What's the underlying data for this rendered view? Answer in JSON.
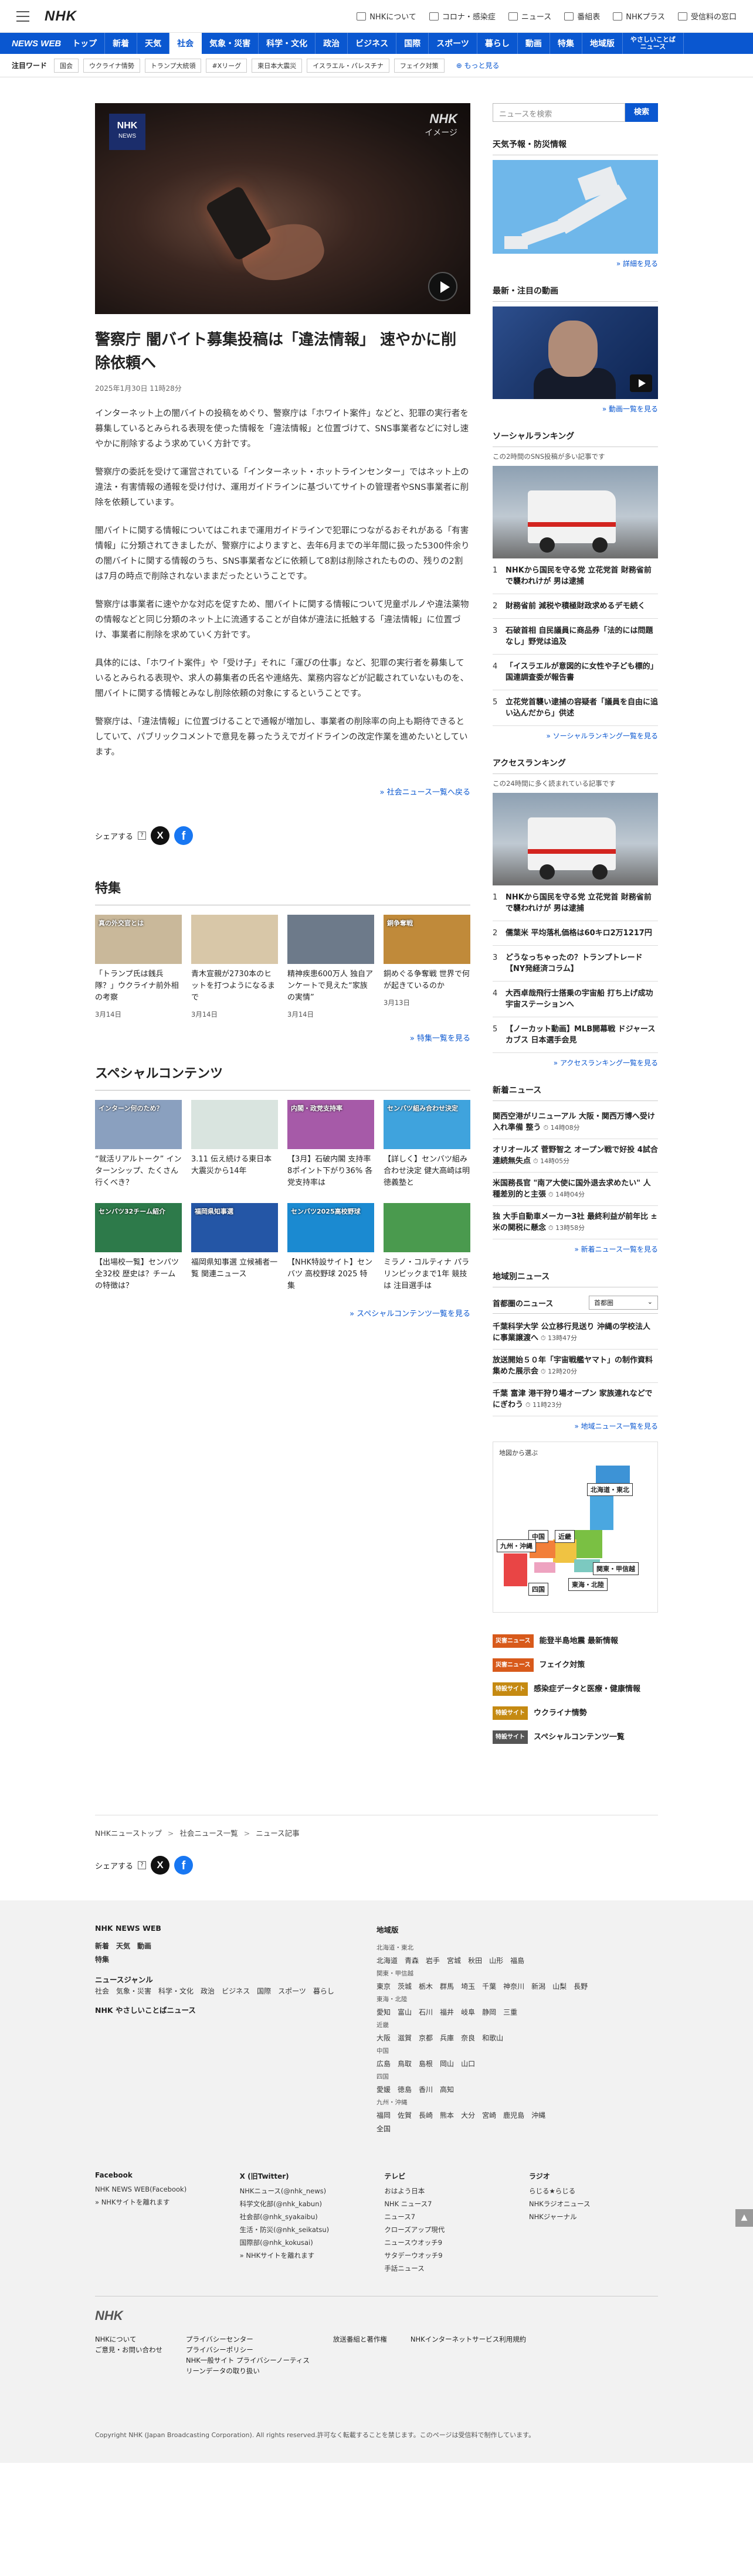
{
  "header": {
    "logo": "NHK",
    "links": [
      "NHKについて",
      "コロナ・感染症",
      "ニュース",
      "番組表",
      "NHKプラス",
      "受信料の窓口"
    ]
  },
  "nav": {
    "brand": "NEWS WEB",
    "items": [
      "トップ",
      "新着",
      "天気",
      "社会",
      "気象・災害",
      "科学・文化",
      "政治",
      "ビジネス",
      "国際",
      "スポーツ",
      "暮らし",
      "動画",
      "特集",
      "地域版"
    ],
    "two_line": "やさしいことば\nニュース",
    "active_index": 3
  },
  "trends": {
    "label": "注目ワード",
    "tags": [
      "国会",
      "ウクライナ情勢",
      "トランプ大統領",
      "#Xリーグ",
      "東日本大震災",
      "イスラエル・パレスチナ",
      "フェイク対策"
    ],
    "more": "もっと見る"
  },
  "article": {
    "image_badge_top": "NHK",
    "image_badge_bottom": "NEWS",
    "image_mark_logo": "NHK",
    "image_mark_text": "イメージ",
    "title": "警察庁 闇バイト募集投稿は「違法情報」 速やかに削除依頼へ",
    "date": "2025年1月30日 11時28分",
    "paragraphs": [
      "インターネット上の闇バイトの投稿をめぐり、警察庁は「ホワイト案件」などと、犯罪の実行者を募集しているとみられる表現を使った情報を「違法情報」と位置づけて、SNS事業者などに対し速やかに削除するよう求めていく方針です。",
      "警察庁の委託を受けて運営されている「インターネット・ホットラインセンター」ではネット上の違法・有害情報の通報を受け付け、運用ガイドラインに基づいてサイトの管理者やSNS事業者に削除を依頼しています。",
      "闇バイトに関する情報についてはこれまで運用ガイドラインで犯罪につながるおそれがある「有害情報」に分類されてきましたが、警察庁によりますと、去年6月までの半年間に扱った5300件余りの闇バイトに関する情報のうち、SNS事業者などに依頼して8割は削除されたものの、残りの2割は7月の時点で削除されないままだったということです。",
      "警察庁は事業者に速やかな対応を促すため、闇バイトに関する情報について児童ポルノや違法薬物の情報などと同じ分類のネット上に流通することが自体が違法に抵触する「違法情報」に位置づけ、事業者に削除を求めていく方針です。",
      "具体的には、「ホワイト案件」や「受け子」それに「運びの仕事」など、犯罪の実行者を募集しているとみられる表現や、求人の募集者の氏名や連絡先、業務内容などが記載されていないものを、闇バイトに関する情報とみなし削除依頼の対象にするということです。",
      "警察庁は、「違法情報」に位置づけることで通報が増加し、事業者の削除率の向上も期待できるとしていて、パブリックコメントで意見を募ったうえでガイドラインの改定作業を進めたいとしています。"
    ],
    "more_link": "社会ニュース一覧へ戻る",
    "share_label": "シェアする",
    "share_help": "?",
    "x_label": "X",
    "fb_label": "f"
  },
  "features": {
    "heading": "特集",
    "cards": [
      {
        "title": "「トランプ氏は銭兵隊？」ウクライナ前外相の考察",
        "date": "3月14日",
        "thumb_text": "真の外交官とは"
      },
      {
        "title": "青木宣親が2730本のヒットを打つようになるまで",
        "date": "3月14日",
        "thumb_text": ""
      },
      {
        "title": "精神疾患600万人 独自アンケートで見えた“家族の実情”",
        "date": "3月14日",
        "thumb_text": ""
      },
      {
        "title": "銅めぐる争奪戦 世界で何が起きているのか",
        "date": "3月13日",
        "thumb_text": "銅争奪戦"
      }
    ],
    "more": "特集一覧を見る"
  },
  "special": {
    "heading": "スペシャルコンテンツ",
    "cards": [
      {
        "title": "“就活リアルトーク” インターンシップ、たくさん行くべき？",
        "thumb_text": "インターン何のため？"
      },
      {
        "title": "3.11 伝え続ける東日本大震災から14年",
        "thumb_text": ""
      },
      {
        "title": "【3月】石破内閣 支持率 8ポイント下がり36% 各党支持率は",
        "thumb_text": "内閣・政党支持率"
      },
      {
        "title": "【詳しく】センバツ組み合わせ決定 健大高崎は明徳義塾と",
        "thumb_text": "センバツ組み合わせ決定"
      },
      {
        "title": "【出場校一覧】センバツ全32校 歴史は？チームの特徴は？",
        "thumb_text": "センバツ32チーム紹介"
      },
      {
        "title": "福岡県知事選 立候補者一覧 関連ニュース",
        "thumb_text": "福岡県知事選"
      },
      {
        "title": "【NHK特設サイト】センバツ 高校野球 2025 特集",
        "thumb_text": "センバツ2025高校野球"
      },
      {
        "title": "ミラノ・コルティナ パラリンピックまで1年 競技は 注目選手は",
        "thumb_text": ""
      }
    ],
    "more": "スペシャルコンテンツ一覧を見る"
  },
  "sidebar": {
    "search_placeholder": "ニュースを検索",
    "search_btn": "検索",
    "weather_h": "天気予報・防災情報",
    "weather_more": "詳細を見る",
    "video_h": "最新・注目の動画",
    "video_more": "動画一覧を見る",
    "social_h": "ソーシャルランキング",
    "social_sub": "この2時間のSNS投稿が多い記事です",
    "social_top": "NHKから国民を守る党 立花党首 財務省前で襲われけが 男は逮捕",
    "social_list": [
      "財務省前 減税や積極財政求めるデモ続く",
      "石破首相 自民議員に商品券「法的には問題なし」野党は追及",
      "「イスラエルが意図的に女性や子ども標的」国連調査委が報告書",
      "立花党首襲い逮捕の容疑者「議員を自由に追い込んだから」供述"
    ],
    "social_more": "ソーシャルランキング一覧を見る",
    "access_h": "アクセスランキング",
    "access_sub": "この24時間に多く読まれている記事です",
    "access_top": "NHKから国民を守る党 立花党首 財務省前で襲われけが 男は逮捕",
    "access_list": [
      "儒葉米 平均落札価格は60キロ2万1217円",
      "どうなっちゃったの？トランプトレード【NY発経済コラム】",
      "大西卓哉飛行士搭乗の宇宙船 打ち上げ成功 宇宙ステーションへ",
      "【ノーカット動画】MLB開幕戦 ドジャース カブス 日本選手会見"
    ],
    "access_more": "アクセスランキング一覧を見る",
    "new_h": "新着ニュース",
    "new_list": [
      {
        "t": "関西空港がリニューアル 大阪・関西万博へ受け入れ準備 整う",
        "time": "14時08分"
      },
      {
        "t": "オリオールズ 菅野智之 オープン戦で好投 4試合連続無失点",
        "time": "14時05分"
      },
      {
        "t": "米国務長官 \"南ア大使に国外退去求めたい\" 人種差別的と主張",
        "time": "14時04分"
      },
      {
        "t": "独 大手自動車メーカー3社 最終利益が前年比 ± 米の関税に懸念",
        "time": "13時58分"
      }
    ],
    "new_more": "新着ニュース一覧を見る",
    "region_h": "地域別ニュース",
    "region_area": "首都圏のニュース",
    "region_select": "首都圏",
    "region_list": [
      {
        "t": "千葉科学大学 公立移行見送り 沖縄の学校法人に事業譲渡へ",
        "time": "13時47分"
      },
      {
        "t": "放送開始５０年「宇宙戦艦ヤマト」の制作資料集めた展示会",
        "time": "12時20分"
      },
      {
        "t": "千葉 富津 港干狩り場オープン 家族連れなどでにぎわう",
        "time": "11時23分"
      }
    ],
    "region_more": "地域ニュース一覧を見る",
    "map_label": "地図から選ぶ",
    "map_regions": [
      "北海道・東北",
      "中国",
      "近畿",
      "関東・甲信越",
      "九州・沖縄",
      "四国",
      "東海・北陸"
    ],
    "tags": [
      {
        "tag": "災害ニュース",
        "t": "能登半島地震 最新情報",
        "color": "#d85a1b"
      },
      {
        "tag": "災害ニュース",
        "t": "フェイク対策",
        "color": "#d85a1b"
      },
      {
        "tag": "特設サイト",
        "t": "感染症データと医療・健康情報",
        "color": "#c58a12"
      },
      {
        "tag": "特設サイト",
        "t": "ウクライナ情勢",
        "color": "#c58a12"
      },
      {
        "tag": "特設サイト",
        "t": "スペシャルコンテンツ一覧",
        "color": "#555555"
      }
    ]
  },
  "breadcrumb": [
    "NHKニューストップ",
    "社会ニュース一覧",
    "ニュース記事"
  ],
  "footer": {
    "col1_h": "NHK NEWS WEB",
    "col1_links": [
      "新着",
      "天気",
      "動画"
    ],
    "col1_h2": "特集",
    "col1_h3": "ニュースジャンル",
    "col1_genres": [
      "社会",
      "気象・災害",
      "科学・文化",
      "政治",
      "ビジネス",
      "国際",
      "スポーツ",
      "暮らし"
    ],
    "col1_h4": "NHK やさしいことばニュース",
    "col2_h": "地域版",
    "regions": [
      {
        "area": "北海道・東北",
        "prefs": [
          "北海道",
          "青森",
          "岩手",
          "宮城",
          "秋田",
          "山形",
          "福島"
        ]
      },
      {
        "area": "関東・甲信越",
        "prefs": [
          "東京",
          "茨城",
          "栃木",
          "群馬",
          "埼玉",
          "千葉",
          "神奈川",
          "新潟",
          "山梨",
          "長野"
        ]
      },
      {
        "area": "東海・北陸",
        "prefs": [
          "愛知",
          "富山",
          "石川",
          "福井",
          "岐阜",
          "静岡",
          "三重"
        ]
      },
      {
        "area": "近畿",
        "prefs": [
          "大阪",
          "滋賀",
          "京都",
          "兵庫",
          "奈良",
          "和歌山"
        ]
      },
      {
        "area": "中国",
        "prefs": [
          "広島",
          "鳥取",
          "島根",
          "岡山",
          "山口"
        ]
      },
      {
        "area": "四国",
        "prefs": [
          "愛媛",
          "徳島",
          "香川",
          "高知"
        ]
      },
      {
        "area": "九州・沖縄",
        "prefs": [
          "福岡",
          "佐賀",
          "長崎",
          "熊本",
          "大分",
          "宮崎",
          "鹿児島",
          "沖縄"
        ]
      },
      {
        "area": "",
        "prefs": [
          "全国"
        ]
      }
    ],
    "sns": [
      {
        "h": "Facebook",
        "links": [
          "NHK NEWS WEB(Facebook)",
          "» NHKサイトを離れます"
        ]
      },
      {
        "h": "X (旧Twitter)",
        "links": [
          "NHKニュース(@nhk_news)",
          "科学文化部(@nhk_kabun)",
          "社会部(@nhk_syakaibu)",
          "生活・防災(@nhk_seikatsu)",
          "国際部(@nhk_kokusai)",
          "» NHKサイトを離れます"
        ]
      },
      {
        "h": "テレビ",
        "links": [
          "おはよう日本",
          "NHK ニュース7",
          "ニュース7",
          "クローズアップ現代",
          "ニュースウオッチ9",
          "サタデーウオッチ9",
          "手話ニュース"
        ]
      },
      {
        "h": "ラジオ",
        "links": [
          "らじる★らじる",
          "NHKラジオニュース",
          "NHKジャーナル"
        ]
      }
    ],
    "logo": "NHK",
    "bottom_links": [
      [
        "NHKについて",
        "ご意見・お問い合わせ"
      ],
      [
        "プライバシーセンター",
        "プライバシーポリシー",
        "NHK一般サイト プライバシーノーティス",
        "リーンデータの取り扱い"
      ],
      [
        "放送番組と著作権"
      ],
      [
        "NHKインターネットサービス利用規約"
      ]
    ],
    "copyright": "Copyright NHK (Japan Broadcasting Corporation). All rights reserved.許可なく転載することを禁じます。このページは受信料で制作しています。"
  }
}
